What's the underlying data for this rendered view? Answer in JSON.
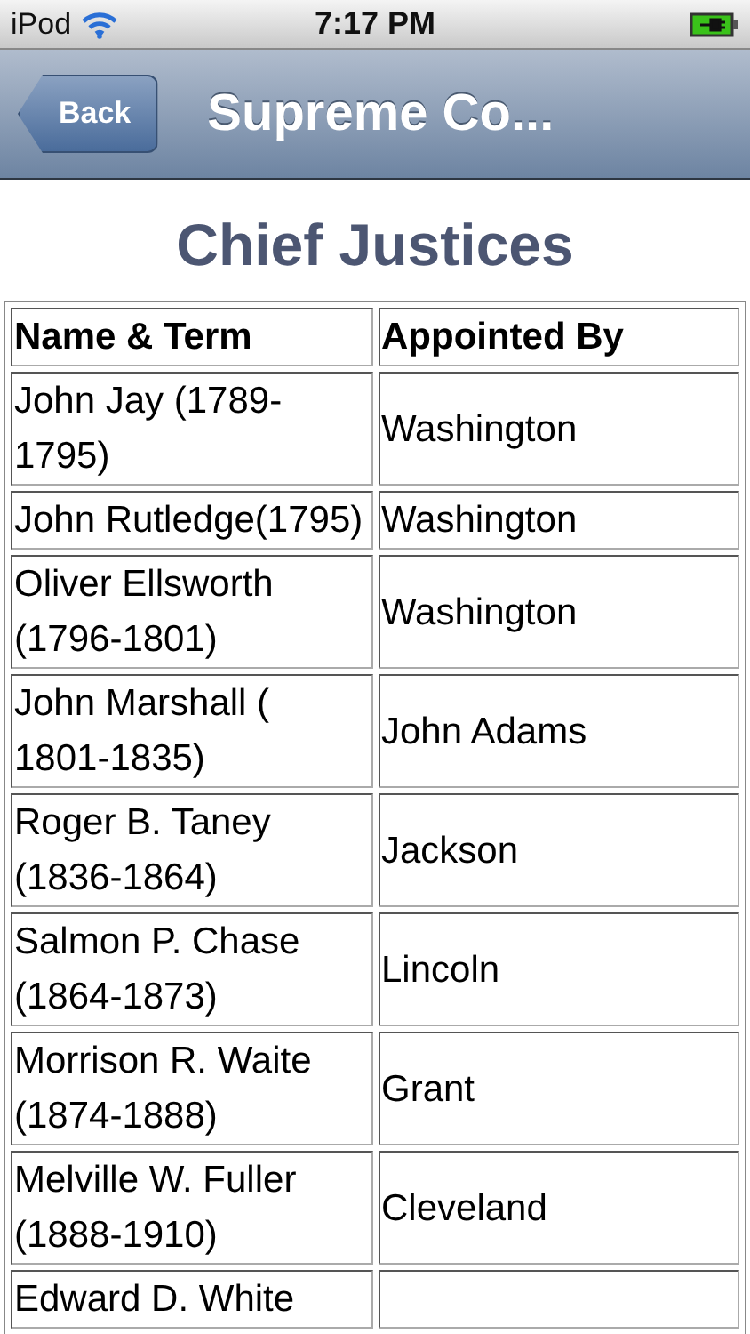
{
  "status_bar": {
    "carrier": "iPod",
    "time": "7:17 PM"
  },
  "nav_bar": {
    "back": "Back",
    "title": "Supreme Co..."
  },
  "heading": "Chief Justices",
  "table": {
    "columns": [
      "Name & Term",
      "Appointed By"
    ],
    "rows": [
      [
        "John Jay (1789-1795)",
        "Washington"
      ],
      [
        "John Rutledge(1795)",
        "Washington"
      ],
      [
        "Oliver Ellsworth (1796-1801)",
        "Washington"
      ],
      [
        "John Marshall ( 1801-1835)",
        "John Adams"
      ],
      [
        "Roger B. Taney (1836-1864)",
        "Jackson"
      ],
      [
        "Salmon P. Chase (1864-1873)",
        "Lincoln"
      ],
      [
        "Morrison R. Waite (1874-1888)",
        "Grant"
      ],
      [
        "Melville W. Fuller (1888-1910)",
        "Cleveland"
      ],
      [
        "Edward D. White"
      ]
    ]
  }
}
